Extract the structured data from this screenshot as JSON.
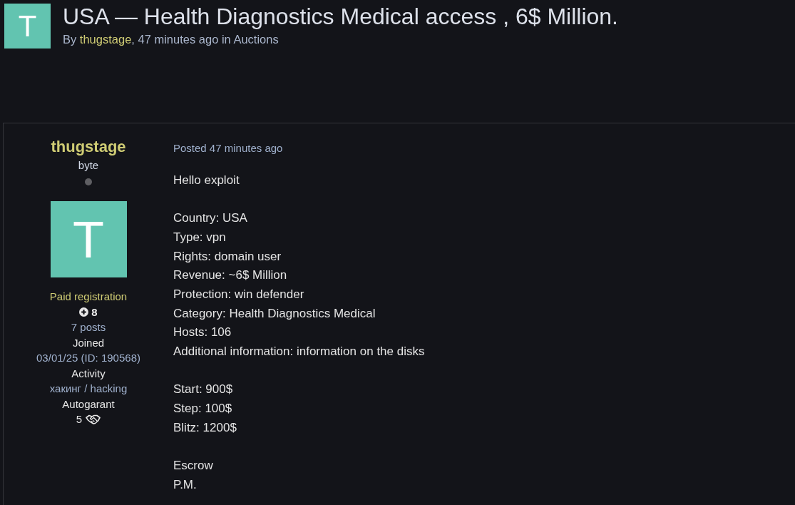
{
  "topic": {
    "avatar_letter": "T",
    "title": "USA — Health Diagnostics Medical access , 6$ Million.",
    "byline": {
      "lead": "By",
      "author": "thugstage",
      "rest": ", 47 minutes ago in Auctions"
    }
  },
  "post": {
    "author": {
      "name": "thugstage",
      "rank": "byte",
      "online": false,
      "avatar_letter": "T",
      "group": "Paid registration",
      "reputation": "8",
      "posts": "7 posts",
      "fields": [
        {
          "kind": "text",
          "label": "Joined",
          "value": "03/01/25 (ID: 190568)"
        },
        {
          "kind": "text",
          "label": "Activity",
          "value": "хакинг / hacking"
        },
        {
          "kind": "deals",
          "label": "Autogarant",
          "value": "5"
        }
      ]
    },
    "posted": "Posted 47 minutes ago",
    "body": [
      [
        "Hello exploit"
      ],
      [
        "Country: USA",
        "Type: vpn",
        "Rights: domain user",
        "Revenue: ~6$ Million",
        "Protection: win defender",
        "Category: Health Diagnostics Medical",
        "Hosts: 106",
        "Additional information: information on the disks"
      ],
      [
        "Start: 900$",
        "Step: 100$",
        "Blitz: 1200$"
      ],
      [
        "Escrow",
        "P.M."
      ]
    ]
  }
}
